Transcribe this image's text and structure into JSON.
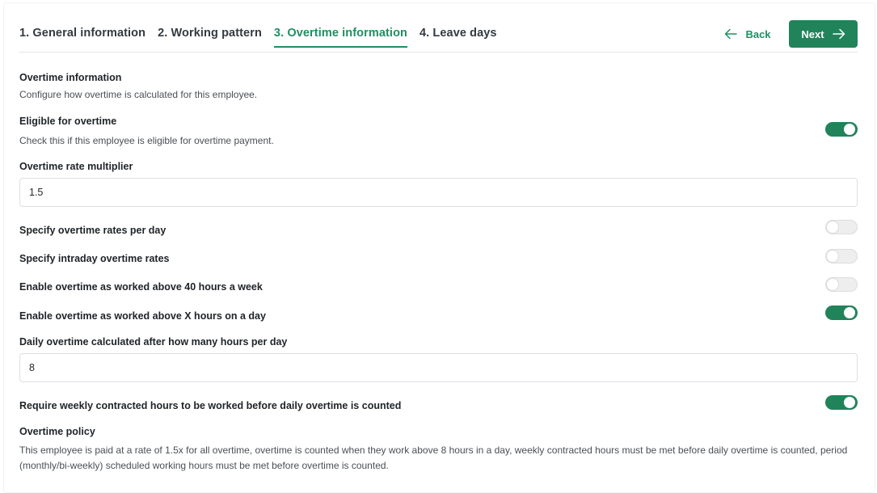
{
  "tabs": [
    {
      "label": "1. General information",
      "active": false
    },
    {
      "label": "2. Working pattern",
      "active": false
    },
    {
      "label": "3. Overtime information",
      "active": true
    },
    {
      "label": "4. Leave days",
      "active": false
    }
  ],
  "nav": {
    "back_label": "Back",
    "next_label": "Next",
    "back_icon": "arrow-left-icon",
    "next_icon": "arrow-right-icon"
  },
  "colors": {
    "accent": "#1f8f62",
    "button_bg": "#21835a",
    "toggle_off": "#eeeeee"
  },
  "overtime": {
    "title": "Overtime information",
    "subtitle": "Configure how overtime is calculated for this employee.",
    "eligible_label": "Eligible for overtime",
    "eligible_desc": "Check this if this employee is eligible for overtime payment.",
    "eligible_on": true,
    "rate_label": "Overtime rate multiplier",
    "rate_value": "1.5",
    "per_day_label": "Specify overtime rates per day",
    "per_day_on": false,
    "intraday_label": "Specify intraday overtime rates",
    "intraday_on": false,
    "above40_label": "Enable overtime as worked above 40 hours a week",
    "above40_on": false,
    "aboveX_label": "Enable overtime as worked above X hours on a day",
    "aboveX_on": true,
    "daily_hours_label": "Daily overtime calculated after how many hours per day",
    "daily_hours_value": "8",
    "require_weekly_label": "Require weekly contracted hours to be worked before daily overtime is counted",
    "require_weekly_on": true,
    "policy_title": "Overtime policy",
    "policy_text": "This employee is paid at a rate of 1.5x for all overtime, overtime is counted when they work above 8 hours in a day, weekly contracted hours must be met before daily overtime is counted, period (monthly/bi-weekly) scheduled working hours must be met before overtime is counted."
  }
}
